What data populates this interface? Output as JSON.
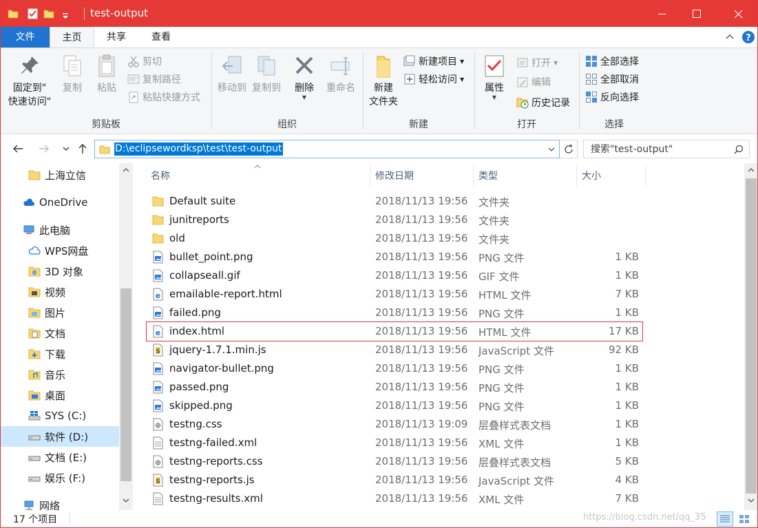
{
  "window": {
    "title": "test-output",
    "accent": "#e53935"
  },
  "ribbon_tabs": [
    "文件",
    "主页",
    "共享",
    "查看"
  ],
  "ribbon": {
    "clipboard": {
      "pin_quick_access": "固定到\"\n快速访问\"",
      "pin_line1": "固定到\"",
      "pin_line2": "快速访问\"",
      "copy": "复制",
      "paste": "粘贴",
      "cut": "剪切",
      "copy_path": "复制路径",
      "paste_shortcut": "粘贴快捷方式",
      "group_label": "剪贴板"
    },
    "organize": {
      "move_to": "移动到",
      "copy_to": "复制到",
      "delete": "删除",
      "rename": "重命名",
      "group_label": "组织"
    },
    "new": {
      "new_folder_line1": "新建",
      "new_folder_line2": "文件夹",
      "new_item": "新建项目",
      "easy_access": "轻松访问",
      "group_label": "新建"
    },
    "open": {
      "properties": "属性",
      "open": "打开",
      "edit": "编辑",
      "history": "历史记录",
      "group_label": "打开"
    },
    "select": {
      "select_all": "全部选择",
      "select_none": "全部取消",
      "invert": "反向选择",
      "group_label": "选择"
    }
  },
  "address": {
    "path": "D:\\eclipsewordksp\\test\\test-output",
    "search_placeholder": "搜索\"test-output\""
  },
  "nav_pane": {
    "items": [
      {
        "label": "上海立信",
        "icon": "folder-icon"
      },
      {
        "label": "OneDrive",
        "icon": "cloud-icon"
      },
      {
        "label": "此电脑",
        "icon": "computer-icon"
      },
      {
        "label": "WPS网盘",
        "icon": "cloud-icon"
      },
      {
        "label": "3D 对象",
        "icon": "cube-icon"
      },
      {
        "label": "视频",
        "icon": "video-icon"
      },
      {
        "label": "图片",
        "icon": "picture-icon"
      },
      {
        "label": "文档",
        "icon": "document-icon"
      },
      {
        "label": "下载",
        "icon": "download-icon"
      },
      {
        "label": "音乐",
        "icon": "music-icon"
      },
      {
        "label": "桌面",
        "icon": "desktop-icon"
      },
      {
        "label": "SYS (C:)",
        "icon": "windows-drive-icon"
      },
      {
        "label": "软件 (D:)",
        "icon": "drive-icon"
      },
      {
        "label": "文档 (E:)",
        "icon": "drive-icon"
      },
      {
        "label": "娱乐 (F:)",
        "icon": "drive-icon"
      },
      {
        "label": "网络",
        "icon": "network-icon"
      }
    ]
  },
  "columns": {
    "name": "名称",
    "date": "修改日期",
    "type": "类型",
    "size": "大小"
  },
  "files": [
    {
      "name": "Default suite",
      "date": "2018/11/13 19:56",
      "type": "文件夹",
      "size": "",
      "icon": "folder-icon"
    },
    {
      "name": "junitreports",
      "date": "2018/11/13 19:56",
      "type": "文件夹",
      "size": "",
      "icon": "folder-icon"
    },
    {
      "name": "old",
      "date": "2018/11/13 19:56",
      "type": "文件夹",
      "size": "",
      "icon": "folder-icon"
    },
    {
      "name": "bullet_point.png",
      "date": "2018/11/13 19:56",
      "type": "PNG 文件",
      "size": "1 KB",
      "icon": "image-file-icon"
    },
    {
      "name": "collapseall.gif",
      "date": "2018/11/13 19:56",
      "type": "GIF 文件",
      "size": "1 KB",
      "icon": "image-file-icon"
    },
    {
      "name": "emailable-report.html",
      "date": "2018/11/13 19:56",
      "type": "HTML 文件",
      "size": "7 KB",
      "icon": "html-file-icon"
    },
    {
      "name": "failed.png",
      "date": "2018/11/13 19:56",
      "type": "PNG 文件",
      "size": "1 KB",
      "icon": "image-file-icon"
    },
    {
      "name": "index.html",
      "date": "2018/11/13 19:56",
      "type": "HTML 文件",
      "size": "17 KB",
      "icon": "html-file-icon"
    },
    {
      "name": "jquery-1.7.1.min.js",
      "date": "2018/11/13 19:56",
      "type": "JavaScript 文件",
      "size": "92 KB",
      "icon": "script-file-icon"
    },
    {
      "name": "navigator-bullet.png",
      "date": "2018/11/13 19:56",
      "type": "PNG 文件",
      "size": "1 KB",
      "icon": "image-file-icon"
    },
    {
      "name": "passed.png",
      "date": "2018/11/13 19:56",
      "type": "PNG 文件",
      "size": "1 KB",
      "icon": "image-file-icon"
    },
    {
      "name": "skipped.png",
      "date": "2018/11/13 19:56",
      "type": "PNG 文件",
      "size": "1 KB",
      "icon": "image-file-icon"
    },
    {
      "name": "testng.css",
      "date": "2018/11/13 19:09",
      "type": "层叠样式表文档",
      "size": "1 KB",
      "icon": "css-file-icon"
    },
    {
      "name": "testng-failed.xml",
      "date": "2018/11/13 19:56",
      "type": "XML 文件",
      "size": "1 KB",
      "icon": "text-file-icon"
    },
    {
      "name": "testng-reports.css",
      "date": "2018/11/13 19:56",
      "type": "层叠样式表文档",
      "size": "5 KB",
      "icon": "css-file-icon"
    },
    {
      "name": "testng-reports.js",
      "date": "2018/11/13 19:56",
      "type": "JavaScript 文件",
      "size": "4 KB",
      "icon": "script-file-icon"
    },
    {
      "name": "testng-results.xml",
      "date": "2018/11/13 19:56",
      "type": "XML 文件",
      "size": "7 KB",
      "icon": "text-file-icon"
    }
  ],
  "status": {
    "item_count": "17 个项目",
    "watermark": "https://blog.csdn.net/qq_35"
  }
}
